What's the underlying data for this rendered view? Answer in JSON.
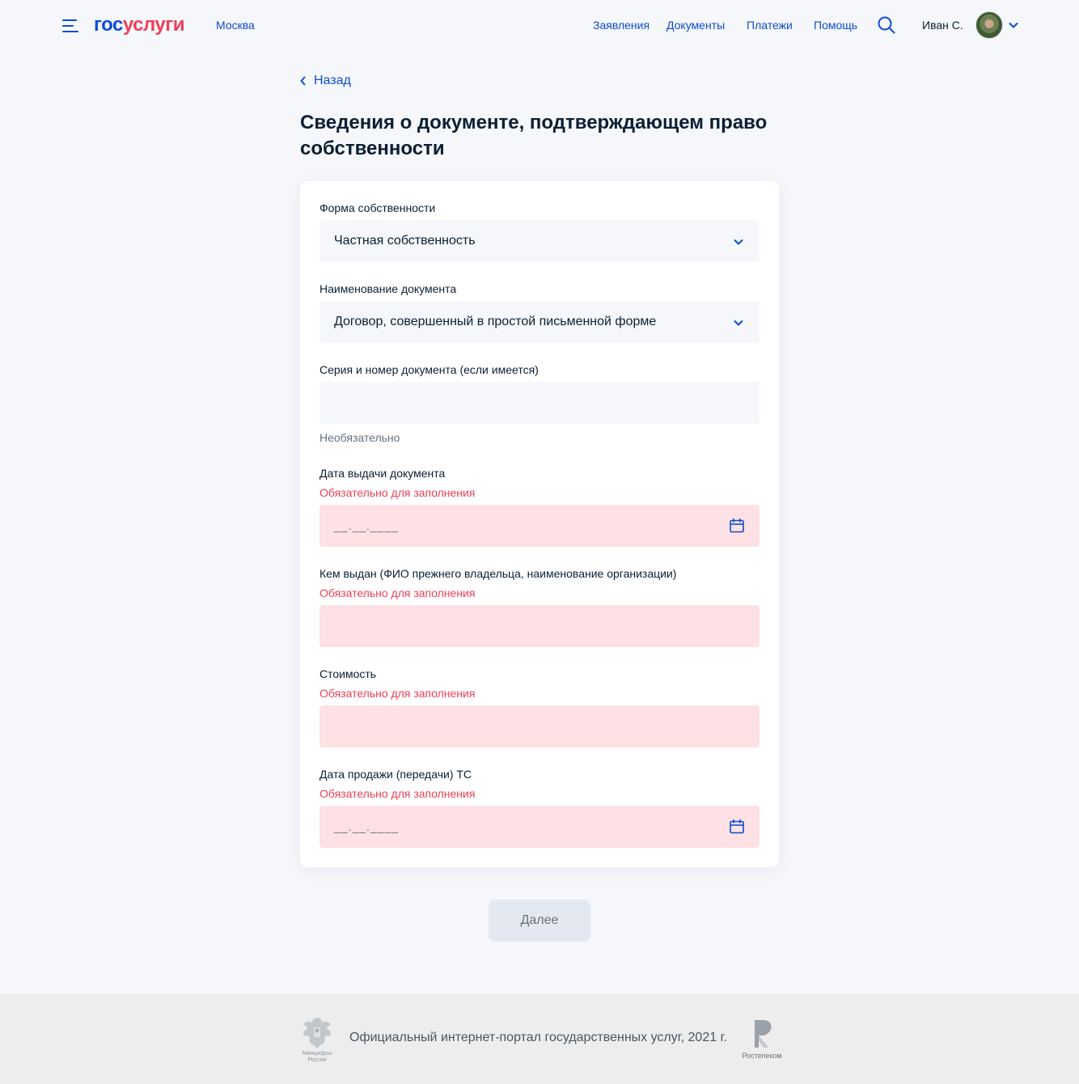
{
  "header": {
    "logo_part1": "гос",
    "logo_part2": "услуги",
    "city": "Москва",
    "nav": [
      "Заявления",
      "Документы",
      "Платежи",
      "Помощь"
    ],
    "user_name": "Иван С."
  },
  "back_label": "Назад",
  "page_title": "Сведения о документе, подтверждающем право собственности",
  "form": {
    "ownership": {
      "label": "Форма собственности",
      "value": "Частная собственность"
    },
    "doc_name": {
      "label": "Наименование документа",
      "value": "Договор, совершенный в простой письменной форме"
    },
    "doc_number": {
      "label": "Серия и номер документа (если имеется)",
      "value": "",
      "hint": "Необязательно"
    },
    "issue_date": {
      "label": "Дата выдачи документа",
      "error": "Обязательно для заполнения",
      "placeholder": "__.__.____"
    },
    "issued_by": {
      "label": "Кем выдан (ФИО прежнего владельца, наименование организации)",
      "error": "Обязательно для заполнения",
      "value": ""
    },
    "price": {
      "label": "Стоимость",
      "error": "Обязательно для заполнения",
      "value": ""
    },
    "sale_date": {
      "label": "Дата продажи (передачи) ТС",
      "error": "Обязательно для заполнения",
      "placeholder": "__.__.____"
    }
  },
  "next_button": "Далее",
  "footer": {
    "text": "Официальный интернет-портал государственных услуг, 2021 г.",
    "emblem_caption": "Минцифры России",
    "partner_caption": "Ростелеком"
  },
  "colors": {
    "accent": "#0d4cd3",
    "brand_red": "#ee3f58",
    "error_bg": "#fde1e4",
    "page_bg": "#f5f7fb"
  },
  "icons": [
    "burger-menu-icon",
    "search-icon",
    "chevron-down-icon",
    "chevron-left-icon",
    "calendar-icon",
    "state-emblem-icon",
    "rostelecom-logo-icon"
  ]
}
